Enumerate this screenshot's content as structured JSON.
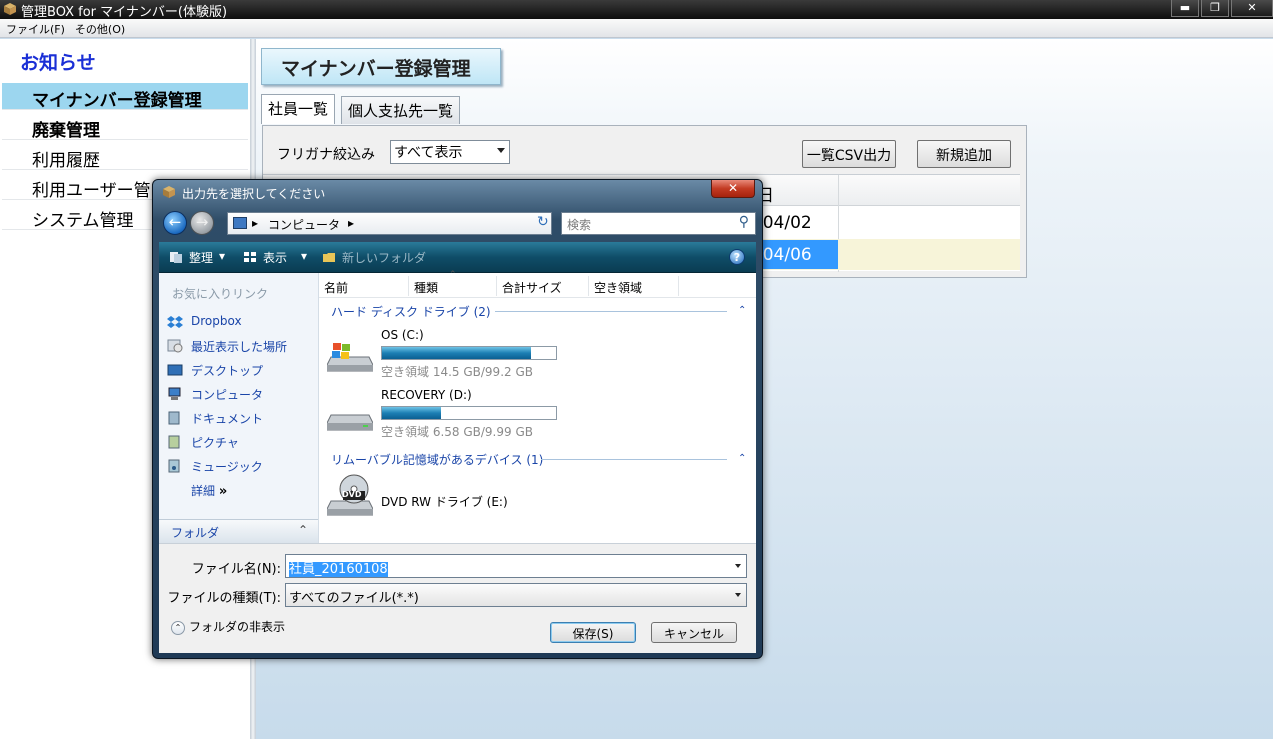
{
  "window": {
    "title": "管理BOX for マイナンバー(体験版)"
  },
  "window_controls": {
    "minimize": "▬",
    "restore": "❐",
    "close": "✕"
  },
  "menu": [
    "ファイル(F)",
    "その他(O)"
  ],
  "sidebar": {
    "heading": "お知らせ",
    "items": [
      {
        "label": "マイナンバー登録管理"
      },
      {
        "label": "廃棄管理"
      },
      {
        "label": "利用履歴"
      },
      {
        "label": "利用ユーザー管"
      },
      {
        "label": "システム管理"
      }
    ]
  },
  "main": {
    "section_title": "マイナンバー登録管理",
    "tabs": [
      "社員一覧",
      "個人支払先一覧"
    ],
    "filter_label": "フリガナ絞込み",
    "filter_value": "すべて表示",
    "csv_button": "一覧CSV出力",
    "add_button": "新規追加",
    "grid": {
      "header_fragment": "日",
      "rows": [
        "/04/02",
        "/04/06"
      ]
    }
  },
  "dialog": {
    "title": "出力先を選択してください",
    "close": "✕",
    "back": "←",
    "forward": "→",
    "address_sep1": "▸",
    "address_path": "コンピュータ",
    "address_sep2": "▸",
    "refresh": "↻",
    "search_placeholder": "検索",
    "search_glyph": "⚲",
    "toolbar": {
      "organize": "整理",
      "view": "表示",
      "new_folder": "新しいフォルダ",
      "dropdown": "▾",
      "help": "?"
    },
    "nav": {
      "favorites_heading": "お気に入りリンク",
      "items": [
        "Dropbox",
        "最近表示した場所",
        "デスクトップ",
        "コンピュータ",
        "ドキュメント",
        "ピクチャ",
        "ミュージック"
      ],
      "more": "詳細",
      "more_glyph": "»",
      "folder_bar": "フォルダ",
      "folder_caret": "⌃"
    },
    "columns": [
      "名前",
      "種類",
      "合計サイズ",
      "空き領域"
    ],
    "sort_indicator": "⌃",
    "group_caret": "⌃",
    "groups": [
      {
        "label": "ハード ディスク ドライブ (2)",
        "drives": [
          {
            "name": "OS (C:)",
            "free": "空き領域 14.5 GB/99.2 GB",
            "used_fraction": 0.854
          },
          {
            "name": "RECOVERY (D:)",
            "free": "空き領域 6.58 GB/9.99 GB",
            "used_fraction": 0.341
          }
        ]
      },
      {
        "label": "リムーバブル記憶域があるデバイス (1)",
        "drives": [
          {
            "name": "DVD RW ドライブ (E:)",
            "badge": "DVD"
          }
        ]
      }
    ],
    "filename_label": "ファイル名(N):",
    "filename_value": "社員_20160108",
    "filetype_label": "ファイルの種類(T):",
    "filetype_value": "すべてのファイル(*.*)",
    "hide_folders": "フォルダの非表示",
    "hide_folders_glyph": "⌃",
    "save_button": "保存(S)",
    "cancel_button": "キャンセル"
  },
  "colors": {
    "accent_blue": "#1a2fd6",
    "selected_sidebar": "#9cd6ef",
    "selection": "#3399ff",
    "row_highlight": "#f7f4d9"
  }
}
